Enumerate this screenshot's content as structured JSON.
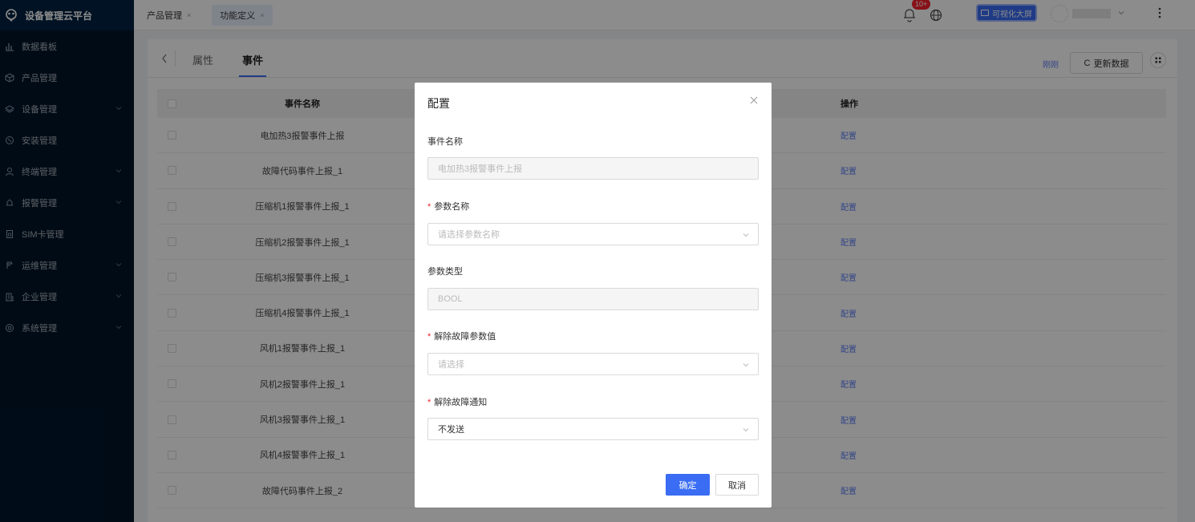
{
  "brand": {
    "title": "设备管理云平台"
  },
  "sidebar": {
    "items": [
      {
        "label": "数据看板",
        "icon": "bar-chart-icon",
        "has_children": false
      },
      {
        "label": "产品管理",
        "icon": "cube-icon",
        "has_children": false
      },
      {
        "label": "设备管理",
        "icon": "layers-icon",
        "has_children": true
      },
      {
        "label": "安装管理",
        "icon": "tool-icon",
        "has_children": false
      },
      {
        "label": "终端管理",
        "icon": "user-icon",
        "has_children": true
      },
      {
        "label": "报警管理",
        "icon": "alarm-icon",
        "has_children": true
      },
      {
        "label": "SIM卡管理",
        "icon": "sim-card-icon",
        "has_children": false
      },
      {
        "label": "运维管理",
        "icon": "wrench-icon",
        "has_children": true
      },
      {
        "label": "企业管理",
        "icon": "building-icon",
        "has_children": true
      },
      {
        "label": "系统管理",
        "icon": "gear-icon",
        "has_children": true
      }
    ]
  },
  "header": {
    "tabs": [
      {
        "label": "产品管理",
        "active": false
      },
      {
        "label": "功能定义",
        "active": true
      }
    ],
    "notification_badge": "10+",
    "big_screen_label": "可视化大屏"
  },
  "main": {
    "subtabs": [
      {
        "label": "属性",
        "active": false
      },
      {
        "label": "事件",
        "active": true
      }
    ],
    "just_now": "刚刚",
    "refresh_label": "更新数据",
    "table": {
      "columns": {
        "name": "事件名称",
        "op": "操作"
      },
      "op_label": "配置",
      "rows": [
        "电加热3报警事件上报",
        "故障代码事件上报_1",
        "压缩机1报警事件上报_1",
        "压缩机2报警事件上报_1",
        "压缩机3报警事件上报_1",
        "压缩机4报警事件上报_1",
        "风机1报警事件上报_1",
        "风机2报警事件上报_1",
        "风机3报警事件上报_1",
        "风机4报警事件上报_1",
        "故障代码事件上报_2"
      ]
    }
  },
  "modal": {
    "title": "配置",
    "event_name_label": "事件名称",
    "event_name_value": "电加热3报警事件上报",
    "param_name_label": "参数名称",
    "param_name_placeholder": "请选择参数名称",
    "param_type_label": "参数类型",
    "param_type_value": "BOOL",
    "clear_value_label": "解除故障参数值",
    "clear_value_placeholder": "请选择",
    "clear_notify_label": "解除故障通知",
    "clear_notify_value": "不发送",
    "ok_label": "确定",
    "cancel_label": "取消"
  },
  "colors": {
    "sidebar_bg": "#001529",
    "primary": "#3a6cf4",
    "link": "#5b7ef5",
    "danger": "#f5222d"
  }
}
